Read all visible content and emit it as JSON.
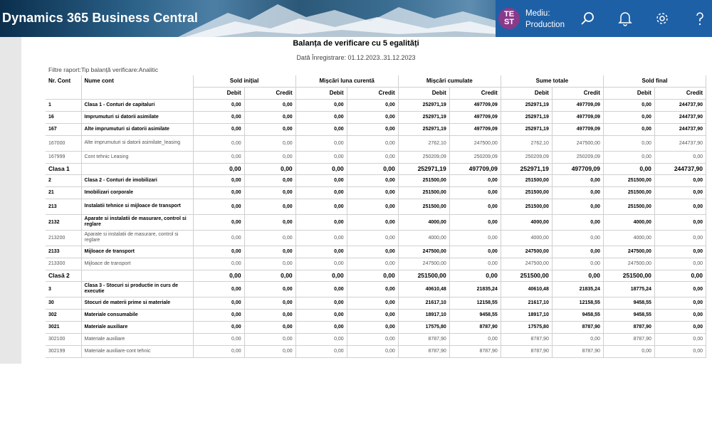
{
  "header": {
    "app_title": "Dynamics 365 Business Central",
    "avatar_initials": "TE ST",
    "env_label": "Mediu:",
    "env_value": "Production",
    "icons": [
      "search-icon",
      "bell-icon",
      "gear-icon",
      "help-icon"
    ],
    "colors": {
      "env_panel": "#1e60a6",
      "avatar": "#8a3a8a"
    }
  },
  "report": {
    "title": "Balanța de verificare cu 5 egalități",
    "date_range": "Dată Înregistrare: 01.12.2023..31.12.2023",
    "filters": "Filtre raport:Tip balanță verificare:Analitic"
  },
  "table": {
    "col_nr": "Nr. Cont",
    "col_name": "Nume cont",
    "groups": [
      "Sold inițial",
      "Mișcări luna curentă",
      "Mișcări cumulate",
      "Sume totale",
      "Sold final"
    ],
    "debit": "Debit",
    "credit": "Credit",
    "rows": [
      {
        "type": "bold",
        "nr": "1",
        "name": "Clasa 1 - Conturi de capitaluri",
        "v": [
          "0,00",
          "0,00",
          "0,00",
          "0,00",
          "252971,19",
          "497709,09",
          "252971,19",
          "497709,09",
          "0,00",
          "244737,90"
        ]
      },
      {
        "type": "bold",
        "nr": "16",
        "name": "Imprumuturi si datorii asimilate",
        "v": [
          "0,00",
          "0,00",
          "0,00",
          "0,00",
          "252971,19",
          "497709,09",
          "252971,19",
          "497709,09",
          "0,00",
          "244737,90"
        ]
      },
      {
        "type": "bold",
        "nr": "167",
        "name": "Alte imprumuturi si datorii asimilate",
        "v": [
          "0,00",
          "0,00",
          "0,00",
          "0,00",
          "252971,19",
          "497709,09",
          "252971,19",
          "497709,09",
          "0,00",
          "244737,90"
        ]
      },
      {
        "type": "normal",
        "nr": "167000",
        "name": "Alte imprumuturi si datorii asimilate_leasing",
        "v": [
          "0,00",
          "0,00",
          "0,00",
          "0,00",
          "2762,10",
          "247500,00",
          "2762,10",
          "247500,00",
          "0,00",
          "244737,90"
        ]
      },
      {
        "type": "normal",
        "nr": "167999",
        "name": "Cont tehnic Leasing",
        "v": [
          "0,00",
          "0,00",
          "0,00",
          "0,00",
          "250209,09",
          "250209,09",
          "250209,09",
          "250209,09",
          "0,00",
          "0,00"
        ]
      },
      {
        "type": "total",
        "nr": "Clasa 1",
        "name": "",
        "v": [
          "0,00",
          "0,00",
          "0,00",
          "0,00",
          "252971,19",
          "497709,09",
          "252971,19",
          "497709,09",
          "0,00",
          "244737,90"
        ]
      },
      {
        "type": "bold",
        "nr": "2",
        "name": "Clasa 2 - Conturi de imobilizari",
        "v": [
          "0,00",
          "0,00",
          "0,00",
          "0,00",
          "251500,00",
          "0,00",
          "251500,00",
          "0,00",
          "251500,00",
          "0,00"
        ]
      },
      {
        "type": "bold",
        "nr": "21",
        "name": "Imobilizari corporale",
        "v": [
          "0,00",
          "0,00",
          "0,00",
          "0,00",
          "251500,00",
          "0,00",
          "251500,00",
          "0,00",
          "251500,00",
          "0,00"
        ]
      },
      {
        "type": "bold",
        "nr": "213",
        "name": "Instalatii tehnice si mijloace de transport",
        "v": [
          "0,00",
          "0,00",
          "0,00",
          "0,00",
          "251500,00",
          "0,00",
          "251500,00",
          "0,00",
          "251500,00",
          "0,00"
        ]
      },
      {
        "type": "bold",
        "nr": "2132",
        "name": "Aparate si instalatii de masurare, control si reglare",
        "v": [
          "0,00",
          "0,00",
          "0,00",
          "0,00",
          "4000,00",
          "0,00",
          "4000,00",
          "0,00",
          "4000,00",
          "0,00"
        ]
      },
      {
        "type": "normal",
        "nr": "213200",
        "name": "Aparate si instalatii de masurare, control si reglare",
        "v": [
          "0,00",
          "0,00",
          "0,00",
          "0,00",
          "4000,00",
          "0,00",
          "4000,00",
          "0,00",
          "4000,00",
          "0,00"
        ]
      },
      {
        "type": "bold",
        "nr": "2133",
        "name": "Mijloace de transport",
        "v": [
          "0,00",
          "0,00",
          "0,00",
          "0,00",
          "247500,00",
          "0,00",
          "247500,00",
          "0,00",
          "247500,00",
          "0,00"
        ]
      },
      {
        "type": "normal",
        "nr": "213300",
        "name": "Mijloace de transport",
        "v": [
          "0,00",
          "0,00",
          "0,00",
          "0,00",
          "247500,00",
          "0,00",
          "247500,00",
          "0,00",
          "247500,00",
          "0,00"
        ]
      },
      {
        "type": "total",
        "nr": "Clasă 2",
        "name": "",
        "v": [
          "0,00",
          "0,00",
          "0,00",
          "0,00",
          "251500,00",
          "0,00",
          "251500,00",
          "0,00",
          "251500,00",
          "0,00"
        ]
      },
      {
        "type": "bold",
        "nr": "3",
        "name": "Clasa 3 - Stocuri si productie in curs de executie",
        "v": [
          "0,00",
          "0,00",
          "0,00",
          "0,00",
          "40610,48",
          "21835,24",
          "40610,48",
          "21835,24",
          "18775,24",
          "0,00"
        ]
      },
      {
        "type": "bold",
        "nr": "30",
        "name": "Stocuri de materii prime si materiale",
        "v": [
          "0,00",
          "0,00",
          "0,00",
          "0,00",
          "21617,10",
          "12158,55",
          "21617,10",
          "12158,55",
          "9458,55",
          "0,00"
        ]
      },
      {
        "type": "bold",
        "nr": "302",
        "name": "Materiale consumabile",
        "v": [
          "0,00",
          "0,00",
          "0,00",
          "0,00",
          "18917,10",
          "9458,55",
          "18917,10",
          "9458,55",
          "9458,55",
          "0,00"
        ]
      },
      {
        "type": "bold",
        "nr": "3021",
        "name": "Materiale auxiliare",
        "v": [
          "0,00",
          "0,00",
          "0,00",
          "0,00",
          "17575,80",
          "8787,90",
          "17575,80",
          "8787,90",
          "8787,90",
          "0,00"
        ]
      },
      {
        "type": "normal",
        "nr": "302100",
        "name": "Materiale auxiliare",
        "v": [
          "0,00",
          "0,00",
          "0,00",
          "0,00",
          "8787,90",
          "0,00",
          "8787,90",
          "0,00",
          "8787,90",
          "0,00"
        ]
      },
      {
        "type": "normal",
        "nr": "302199",
        "name": "Materiale auxiliare-cont tehnic",
        "v": [
          "0,00",
          "0,00",
          "0,00",
          "0,00",
          "8787,90",
          "8787,90",
          "8787,90",
          "8787,90",
          "0,00",
          "0,00"
        ]
      }
    ]
  }
}
